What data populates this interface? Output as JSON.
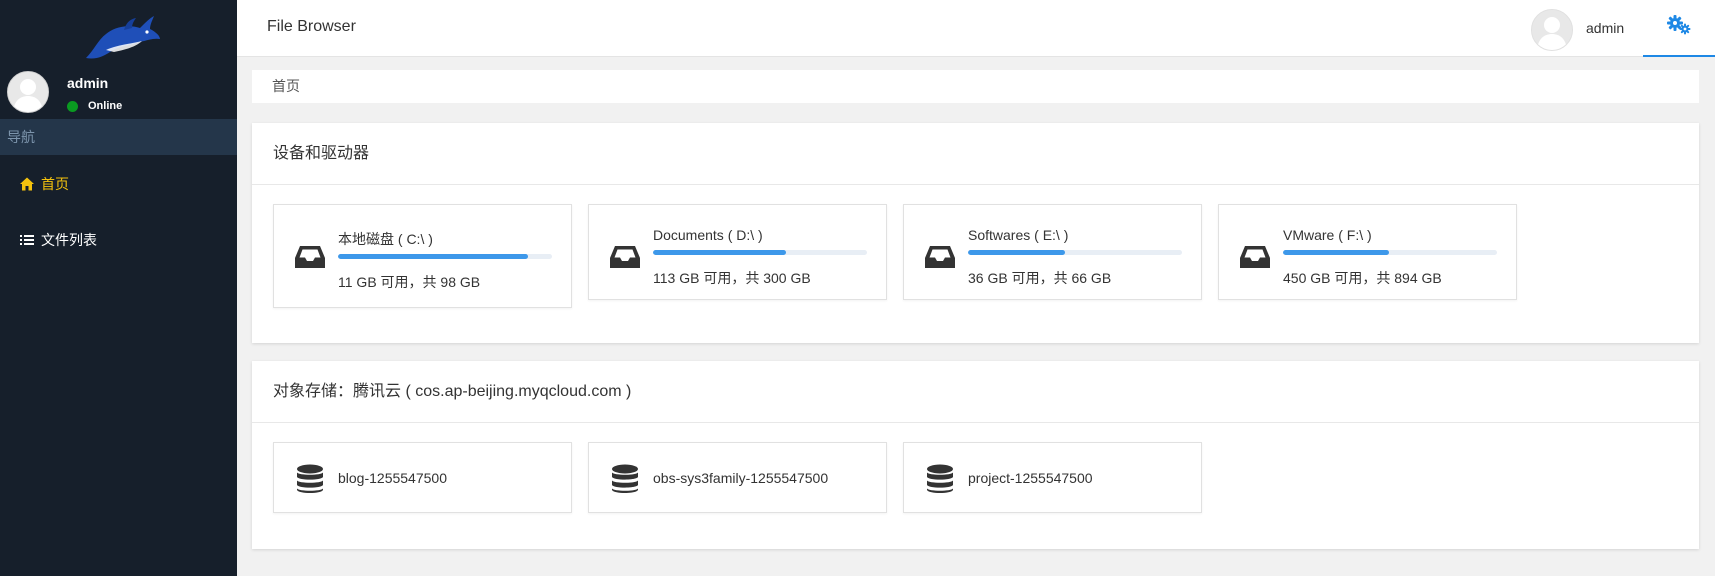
{
  "app": {
    "title": "File Browser"
  },
  "sidebar": {
    "user": {
      "name": "admin",
      "status": "Online",
      "status_color": "#0a9a21"
    },
    "nav_header": "导航",
    "items": [
      {
        "label": "首页",
        "icon": "home-icon",
        "active": true
      },
      {
        "label": "文件列表",
        "icon": "list-icon",
        "active": false
      }
    ]
  },
  "topbar": {
    "user_name": "admin",
    "settings_icon": "gears-icon"
  },
  "breadcrumb": "首页",
  "drives": {
    "title": "设备和驱动器",
    "items": [
      {
        "name": "本地磁盘 ( C:\\ )",
        "usage": "11 GB 可用，共 98 GB",
        "used_fraction": 0.888
      },
      {
        "name": "Documents ( D:\\ )",
        "usage": "113 GB 可用，共 300 GB",
        "used_fraction": 0.623
      },
      {
        "name": "Softwares ( E:\\ )",
        "usage": "36 GB 可用，共 66 GB",
        "used_fraction": 0.455
      },
      {
        "name": "VMware ( F:\\ )",
        "usage": "450 GB 可用，共 894 GB",
        "used_fraction": 0.497
      }
    ]
  },
  "object_storage": {
    "title": "对象存储：腾讯云 ( cos.ap-beijing.myqcloud.com )",
    "buckets": [
      {
        "name": "blog-1255547500"
      },
      {
        "name": "obs-sys3family-1255547500"
      },
      {
        "name": "project-1255547500"
      }
    ]
  },
  "colors": {
    "sidebar_bg": "#161f2b",
    "accent": "#1e88e5",
    "active_nav": "#f4c20d",
    "progress": "#3d98ea"
  }
}
